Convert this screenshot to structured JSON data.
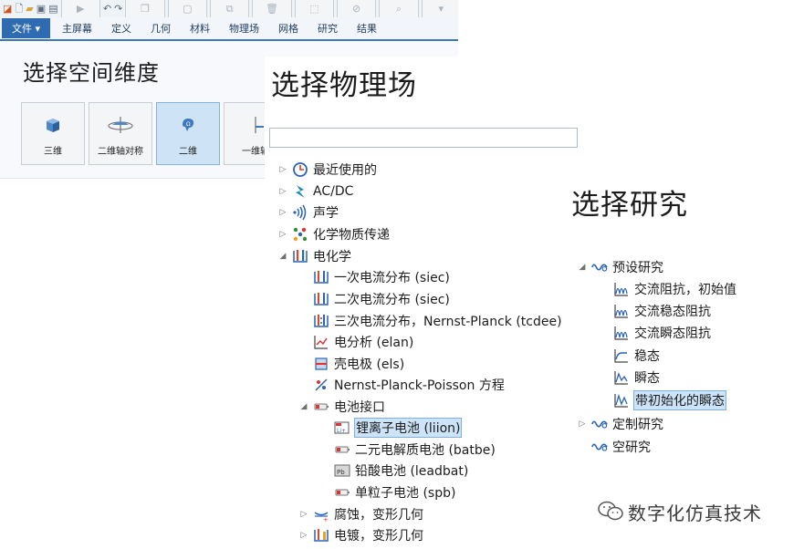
{
  "space_panel": {
    "quick_access_icons": [
      "app-logo-icon",
      "new-file-icon",
      "open-folder-icon",
      "save-icon",
      "save-as-icon",
      "run-icon",
      "undo-icon",
      "redo-icon",
      "copy-icon",
      "paste-icon",
      "duplicate-icon",
      "delete-icon",
      "select-icon",
      "deselect-icon",
      "zoom-icon",
      "dropdown-icon"
    ],
    "file_tab": "文件 ▾",
    "ribbon_tabs": [
      "主屏幕",
      "定义",
      "几何",
      "材料",
      "物理场",
      "网格",
      "研究",
      "结果"
    ],
    "title": "选择空间维度",
    "dimensions": [
      {
        "label": "三维",
        "icon": "cube-icon",
        "selected": false
      },
      {
        "label": "二维轴对称",
        "icon": "axisymmetric-icon",
        "selected": false
      },
      {
        "label": "二维",
        "icon": "2d-icon",
        "selected": true
      },
      {
        "label": "一维轴",
        "icon": "1d-axisymmetric-icon",
        "selected": false
      }
    ]
  },
  "physics_panel": {
    "title": "选择物理场",
    "search_value": "",
    "tree": [
      {
        "label": "最近使用的",
        "icon": "recent-icon",
        "expander": "collapsed",
        "level": 0
      },
      {
        "label": "AC/DC",
        "icon": "acdc-icon",
        "expander": "collapsed",
        "level": 0
      },
      {
        "label": "声学",
        "icon": "acoustics-icon",
        "expander": "collapsed",
        "level": 0
      },
      {
        "label": "化学物质传递",
        "icon": "chemical-transport-icon",
        "expander": "collapsed",
        "level": 0
      },
      {
        "label": "电化学",
        "icon": "electrochemistry-icon",
        "expander": "expanded",
        "level": 0
      },
      {
        "label": "一次电流分布 (siec)",
        "icon": "current-distribution-icon",
        "expander": "none",
        "level": 1
      },
      {
        "label": "二次电流分布 (siec)",
        "icon": "current-distribution-icon",
        "expander": "none",
        "level": 1
      },
      {
        "label": "三次电流分布，Nernst-Planck (tcdee)",
        "icon": "tertiary-current-icon",
        "expander": "none",
        "level": 1
      },
      {
        "label": "电分析 (elan)",
        "icon": "electroanalysis-icon",
        "expander": "none",
        "level": 1
      },
      {
        "label": "壳电极 (els)",
        "icon": "shell-electrode-icon",
        "expander": "none",
        "level": 1
      },
      {
        "label": "Nernst-Planck-Poisson 方程",
        "icon": "nernst-planck-poisson-icon",
        "expander": "none",
        "level": 1
      },
      {
        "label": "电池接口",
        "icon": "battery-icon",
        "expander": "expanded",
        "level": 1
      },
      {
        "label": "锂离子电池 (liion)",
        "icon": "li-ion-battery-icon",
        "expander": "none",
        "level": 2,
        "selected": true
      },
      {
        "label": "二元电解质电池 (batbe)",
        "icon": "battery-icon",
        "expander": "none",
        "level": 2
      },
      {
        "label": "铅酸电池 (leadbat)",
        "icon": "lead-acid-battery-icon",
        "expander": "none",
        "level": 2
      },
      {
        "label": "单粒子电池 (spb)",
        "icon": "battery-icon",
        "expander": "none",
        "level": 2
      },
      {
        "label": "腐蚀，变形几何",
        "icon": "corrosion-icon",
        "expander": "collapsed",
        "level": 1
      },
      {
        "label": "电镀，变形几何",
        "icon": "electrodeposition-icon",
        "expander": "collapsed",
        "level": 1
      }
    ]
  },
  "study_panel": {
    "title": "选择研究",
    "tree": [
      {
        "label": "预设研究",
        "icon": "preset-studies-icon",
        "expander": "expanded",
        "level": 0
      },
      {
        "label": "交流阻抗，初始值",
        "icon": "ac-impedance-icon",
        "expander": "none",
        "level": 1
      },
      {
        "label": "交流稳态阻抗",
        "icon": "ac-impedance-icon",
        "expander": "none",
        "level": 1
      },
      {
        "label": "交流瞬态阻抗",
        "icon": "ac-impedance-icon",
        "expander": "none",
        "level": 1
      },
      {
        "label": "稳态",
        "icon": "stationary-icon",
        "expander": "none",
        "level": 1
      },
      {
        "label": "瞬态",
        "icon": "time-dependent-icon",
        "expander": "none",
        "level": 1
      },
      {
        "label": "带初始化的瞬态",
        "icon": "time-dependent-init-icon",
        "expander": "none",
        "level": 1,
        "selected": true
      },
      {
        "label": "定制研究",
        "icon": "custom-studies-icon",
        "expander": "collapsed",
        "level": 0
      },
      {
        "label": "空研究",
        "icon": "empty-study-icon",
        "expander": "none",
        "level": 0
      }
    ]
  },
  "watermark": {
    "text": "数字化仿真技术",
    "icon": "wechat-icon"
  },
  "colors": {
    "ribbon_blue": "#2e6bb0",
    "selection_bg": "#cde4f8",
    "selection_border": "#7fb0e0",
    "tree_icon_blue": "#2a64b8"
  }
}
